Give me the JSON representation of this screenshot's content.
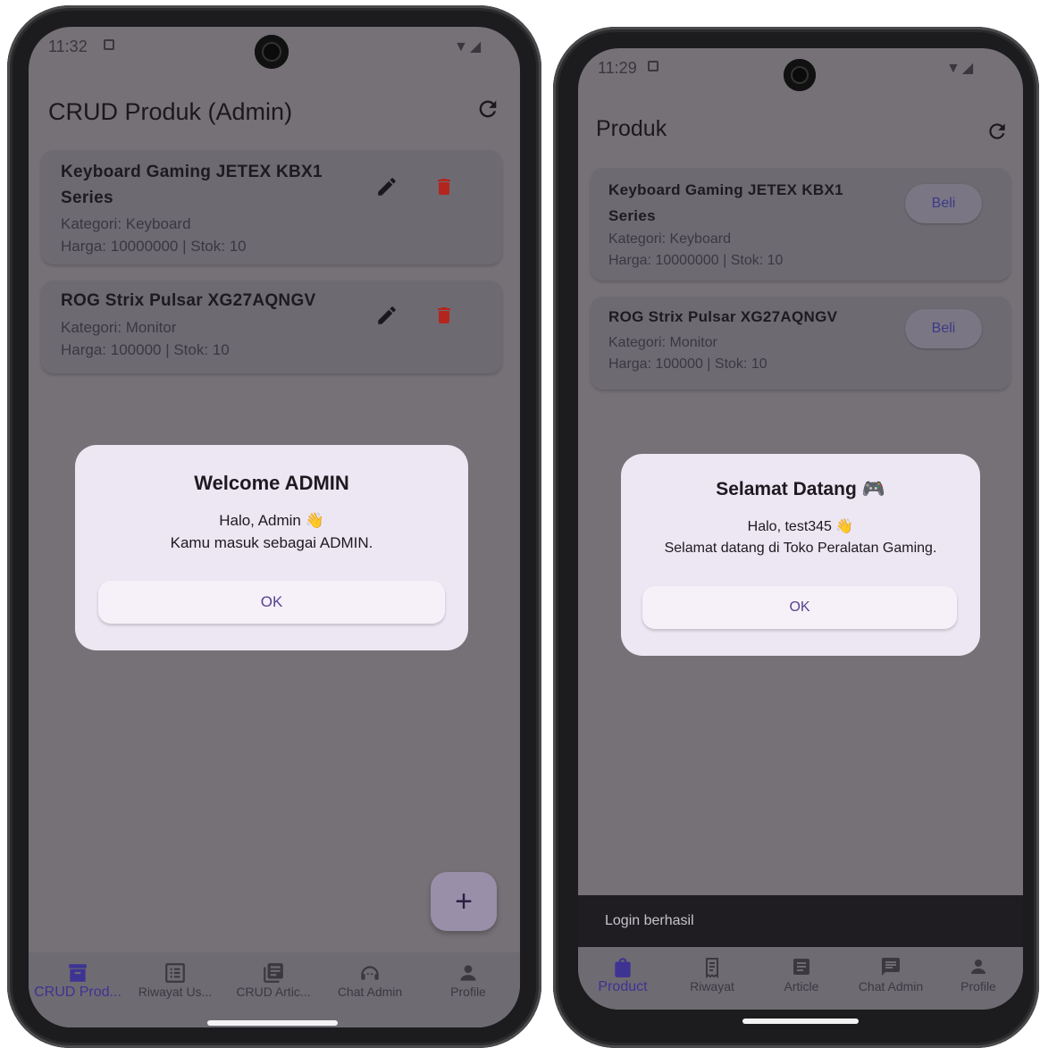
{
  "left": {
    "status": {
      "time": "11:32"
    },
    "appbar": {
      "title": "CRUD Produk (Admin)",
      "refresh_icon": "refresh-icon"
    },
    "products": [
      {
        "name_line1": "Keyboard Gaming JETEX KBX1",
        "name_line2": "Series",
        "category": "Kategori: Keyboard",
        "price_stock": "Harga: 10000000 | Stok: 10"
      },
      {
        "name_line1": "ROG Strix Pulsar XG27AQNGV",
        "name_line2": "",
        "category": "Kategori: Monitor",
        "price_stock": "Harga: 100000 | Stok: 10"
      }
    ],
    "dialog": {
      "title": "Welcome ADMIN",
      "line1": "Halo, Admin 👋",
      "line2": "Kamu masuk sebagai ADMIN.",
      "ok": "OK"
    },
    "fab": {
      "label": "+"
    },
    "nav": [
      {
        "label": "CRUD Prod...",
        "icon": "archive-icon",
        "active": true
      },
      {
        "label": "Riwayat Us...",
        "icon": "list-icon",
        "active": false
      },
      {
        "label": "CRUD Artic...",
        "icon": "library-icon",
        "active": false
      },
      {
        "label": "Chat Admin",
        "icon": "support-agent-icon",
        "active": false
      },
      {
        "label": "Profile",
        "icon": "person-icon",
        "active": false
      }
    ]
  },
  "right": {
    "status": {
      "time": "11:29"
    },
    "appbar": {
      "title": "Produk",
      "refresh_icon": "refresh-icon"
    },
    "products": [
      {
        "name_line1": "Keyboard Gaming JETEX KBX1",
        "name_line2": "Series",
        "category": "Kategori: Keyboard",
        "price_stock": "Harga: 10000000 | Stok: 10",
        "buy": "Beli"
      },
      {
        "name_line1": "ROG Strix Pulsar XG27AQNGV",
        "name_line2": "",
        "category": "Kategori: Monitor",
        "price_stock": "Harga: 100000 | Stok: 10",
        "buy": "Beli"
      }
    ],
    "dialog": {
      "title": "Selamat Datang 🎮",
      "line1": "Halo, test345 👋",
      "line2": "Selamat datang di Toko Peralatan Gaming.",
      "ok": "OK"
    },
    "snackbar": "Login berhasil",
    "nav": [
      {
        "label": "Product",
        "icon": "shopping-bag-icon",
        "active": true
      },
      {
        "label": "Riwayat",
        "icon": "receipt-icon",
        "active": false
      },
      {
        "label": "Article",
        "icon": "article-icon",
        "active": false
      },
      {
        "label": "Chat Admin",
        "icon": "chat-icon",
        "active": false
      },
      {
        "label": "Profile",
        "icon": "person-icon",
        "active": false
      }
    ]
  },
  "colors": {
    "accent": "#3d3392",
    "delete": "#b3261e",
    "scrim": "#757177",
    "dialog": "#ede6f3"
  }
}
